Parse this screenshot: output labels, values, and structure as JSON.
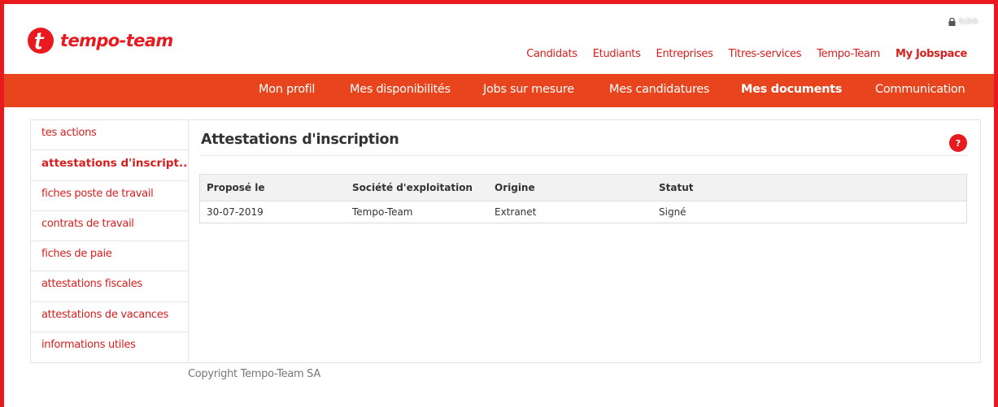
{
  "header": {
    "logo_text": "tempo-team",
    "user_name": "bjbb"
  },
  "top_nav": [
    {
      "label": "Candidats",
      "active": false
    },
    {
      "label": "Etudiants",
      "active": false
    },
    {
      "label": "Entreprises",
      "active": false
    },
    {
      "label": "Titres-services",
      "active": false
    },
    {
      "label": "Tempo-Team",
      "active": false
    },
    {
      "label": "My Jobspace",
      "active": true
    }
  ],
  "main_nav": [
    {
      "label": "Mon profil",
      "active": false
    },
    {
      "label": "Mes disponibilités",
      "active": false
    },
    {
      "label": "Jobs sur mesure",
      "active": false
    },
    {
      "label": "Mes candidatures",
      "active": false
    },
    {
      "label": "Mes documents",
      "active": true
    },
    {
      "label": "Communication",
      "active": false
    }
  ],
  "sidebar": {
    "items": [
      {
        "label": "tes actions",
        "active": false
      },
      {
        "label": "attestations d'inscript...",
        "active": true
      },
      {
        "label": "fiches poste de travail",
        "active": false
      },
      {
        "label": "contrats de travail",
        "active": false
      },
      {
        "label": "fiches de paie",
        "active": false
      },
      {
        "label": "attestations fiscales",
        "active": false
      },
      {
        "label": "attestations de vacances",
        "active": false
      },
      {
        "label": "informations utiles",
        "active": false
      }
    ]
  },
  "main": {
    "title": "Attestations d'inscription",
    "help_label": "?",
    "table": {
      "headers": [
        "Proposé le",
        "Société d'exploitation",
        "Origine",
        "Statut"
      ],
      "rows": [
        [
          "30-07-2019",
          "Tempo-Team",
          "Extranet",
          "Signé"
        ]
      ]
    }
  },
  "footer": {
    "copyright": "Copyright Tempo-Team SA"
  },
  "colors": {
    "brand_red": "#e8191f",
    "nav_orange": "#e8441d",
    "link_red": "#d81e1e"
  },
  "icons": {
    "logo": "tempo-team-logo-icon",
    "lock": "lock-icon",
    "help": "help-icon"
  }
}
